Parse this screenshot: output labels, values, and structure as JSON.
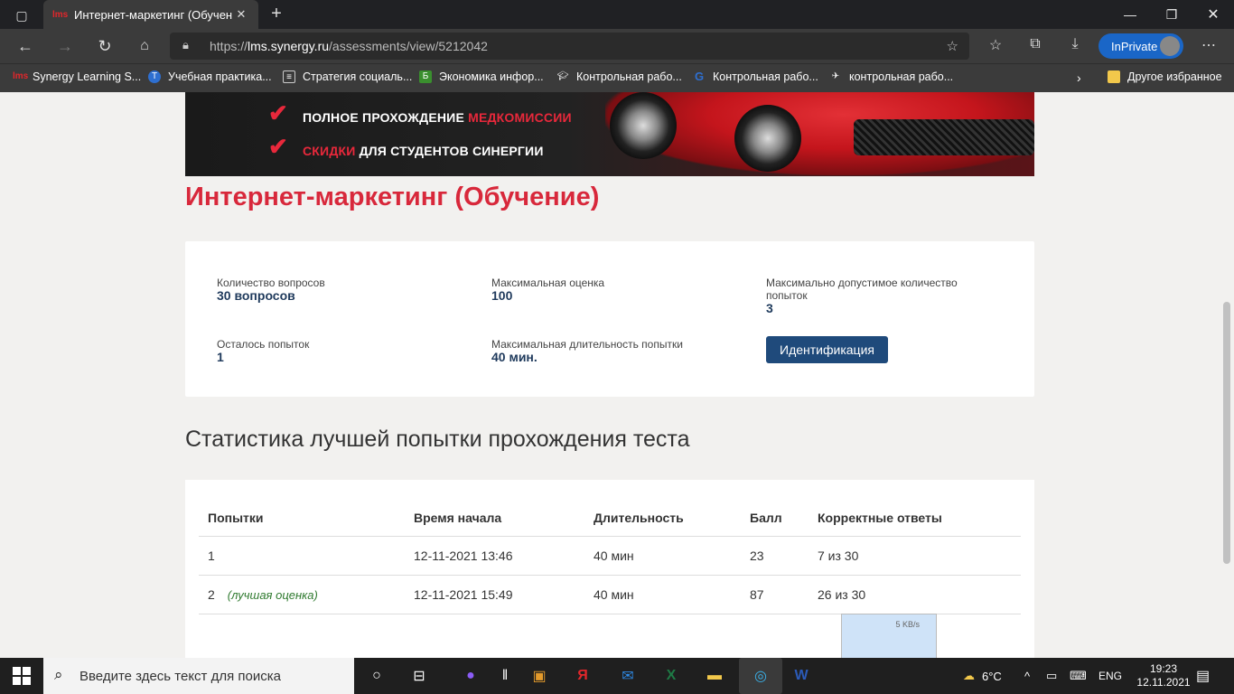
{
  "browser": {
    "tab_title": "Интернет-маркетинг (Обучение",
    "url_prefix": "https://",
    "url_host": "lms.synergy.ru",
    "url_path": "/assessments/view/5212042",
    "inprivate_label": "InPrivate",
    "favicon_text": "lms"
  },
  "bookmarks": [
    {
      "label": "Synergy Learning S...",
      "icon": "lms-icon",
      "color": "#e3262b"
    },
    {
      "label": "Учебная практика...",
      "icon": "t-logo-icon",
      "color": "#2e6fd0"
    },
    {
      "label": "Стратегия социаль...",
      "icon": "document-icon",
      "color": "#fff"
    },
    {
      "label": "Экономика инфор...",
      "icon": "b-logo-icon",
      "color": "#3a8f2e"
    },
    {
      "label": "Контрольная рабо...",
      "icon": "cap-icon",
      "color": "#fff"
    },
    {
      "label": "Контрольная рабо...",
      "icon": "g-logo-icon",
      "color": "#2e6fd0"
    },
    {
      "label": "контрольная рабо...",
      "icon": "bird-icon",
      "color": "#fff"
    }
  ],
  "other_favorites": "Другое избранное",
  "banner": {
    "line1_white": "ПОЛНОЕ ПРОХОЖДЕНИЕ ",
    "line1_red": "МЕДКОМИССИИ",
    "line2_red": "СКИДКИ",
    "line2_white": " ДЛЯ СТУДЕНТОВ СИНЕРГИИ"
  },
  "page_title": "Интернет-маркетинг (Обучение)",
  "info": {
    "questions_label": "Количество вопросов",
    "questions_value": "30 вопросов",
    "max_score_label": "Максимальная оценка",
    "max_score_value": "100",
    "max_attempts_label_1": "Максимально допустимое количество",
    "max_attempts_label_2": "попыток",
    "max_attempts_value": "3",
    "left_label": "Осталось попыток",
    "left_value": "1",
    "duration_label": "Максимальная длительность попытки",
    "duration_value": "40 мин.",
    "id_button": "Идентификация"
  },
  "stats_title": "Статистика лучшей попытки прохождения теста",
  "table": {
    "headers": [
      "Попытки",
      "Время начала",
      "Длительность",
      "Балл",
      "Корректные ответы"
    ],
    "rows": [
      {
        "attempt": "1",
        "note": "",
        "start": "12-11-2021 13:46",
        "duration": "40 мин",
        "score": "23",
        "correct": "7 из 30"
      },
      {
        "attempt": "2",
        "note": "(лучшая оценка)",
        "start": "12-11-2021 15:49",
        "duration": "40 мин",
        "score": "87",
        "correct": "26 из 30"
      }
    ]
  },
  "popup_speed": "5 KB/s",
  "taskbar": {
    "search_placeholder": "Введите здесь текст для поиска",
    "weather": "6°C",
    "lang": "ENG",
    "time": "19:23",
    "date": "12.11.2021"
  }
}
